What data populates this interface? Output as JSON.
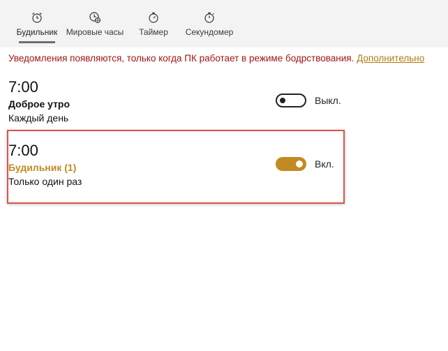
{
  "tabs": [
    {
      "label": "Будильник",
      "icon": "alarm-clock-icon",
      "active": true
    },
    {
      "label": "Мировые часы",
      "icon": "world-clock-icon",
      "active": false
    },
    {
      "label": "Таймер",
      "icon": "timer-icon",
      "active": false
    },
    {
      "label": "Секундомер",
      "icon": "stopwatch-icon",
      "active": false
    }
  ],
  "notice": {
    "text": "Уведомления появляются, только когда ПК работает в режиме бодрствования.",
    "link": "Дополнительно"
  },
  "alarms": [
    {
      "time": "7:00",
      "name": "Доброе утро",
      "repeat": "Каждый день",
      "enabled": false,
      "state_label": "Выкл."
    },
    {
      "time": "7:00",
      "name": "Будильник (1)",
      "repeat": "Только один раз",
      "enabled": true,
      "state_label": "Вкл."
    }
  ],
  "colors": {
    "accent": "#c28a22",
    "notice": "#a31515",
    "highlight_border": "#d9534f"
  }
}
